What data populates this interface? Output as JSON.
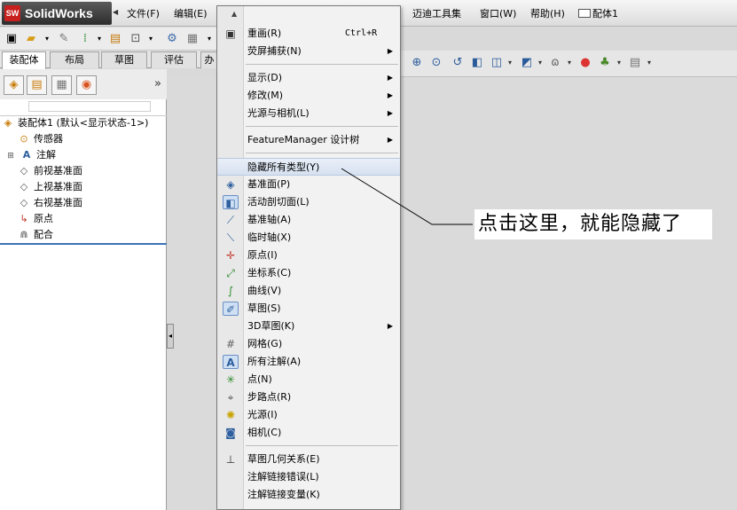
{
  "app": {
    "logo_text": "SolidWorks",
    "doc_title": "配体1"
  },
  "menubar": {
    "items": [
      {
        "label": "文件(F)"
      },
      {
        "label": "编辑(E)"
      },
      {
        "label": "迈迪工具集"
      },
      {
        "label": "窗口(W)"
      },
      {
        "label": "帮助(H)"
      }
    ]
  },
  "command_tabs": [
    "装配体",
    "布局",
    "草图",
    "评估",
    "办"
  ],
  "feature_tree": {
    "root": "装配体1  (默认<显示状态-1>)",
    "items": [
      "传感器",
      "注解",
      "前视基准面",
      "上视基准面",
      "右视基准面",
      "原点",
      "配合"
    ]
  },
  "dropdown": {
    "items": [
      {
        "label": "重画(R)",
        "accel": "Ctrl+R"
      },
      {
        "label": "荧屏捕获(N)"
      },
      {
        "label": "显示(D)"
      },
      {
        "label": "修改(M)"
      },
      {
        "label": "光源与相机(L)"
      },
      {
        "label": "FeatureManager 设计树"
      },
      {
        "label": "隐藏所有类型(Y)"
      },
      {
        "label": "基准面(P)"
      },
      {
        "label": "活动剖切面(L)"
      },
      {
        "label": "基准轴(A)"
      },
      {
        "label": "临时轴(X)"
      },
      {
        "label": "原点(I)"
      },
      {
        "label": "坐标系(C)"
      },
      {
        "label": "曲线(V)"
      },
      {
        "label": "草图(S)"
      },
      {
        "label": "3D草图(K)"
      },
      {
        "label": "网格(G)"
      },
      {
        "label": "所有注解(A)"
      },
      {
        "label": "点(N)"
      },
      {
        "label": "步路点(R)"
      },
      {
        "label": "光源(I)"
      },
      {
        "label": "相机(C)"
      },
      {
        "label": "草图几何关系(E)"
      },
      {
        "label": "注解链接错误(L)"
      },
      {
        "label": "注解链接变量(K)"
      }
    ]
  },
  "annotation": {
    "text": "点击这里，就能隐藏了"
  },
  "colors": {
    "highlight": "#d6e1f0",
    "tree_accent": "#3b73b9",
    "logo_red": "#c8201f"
  }
}
